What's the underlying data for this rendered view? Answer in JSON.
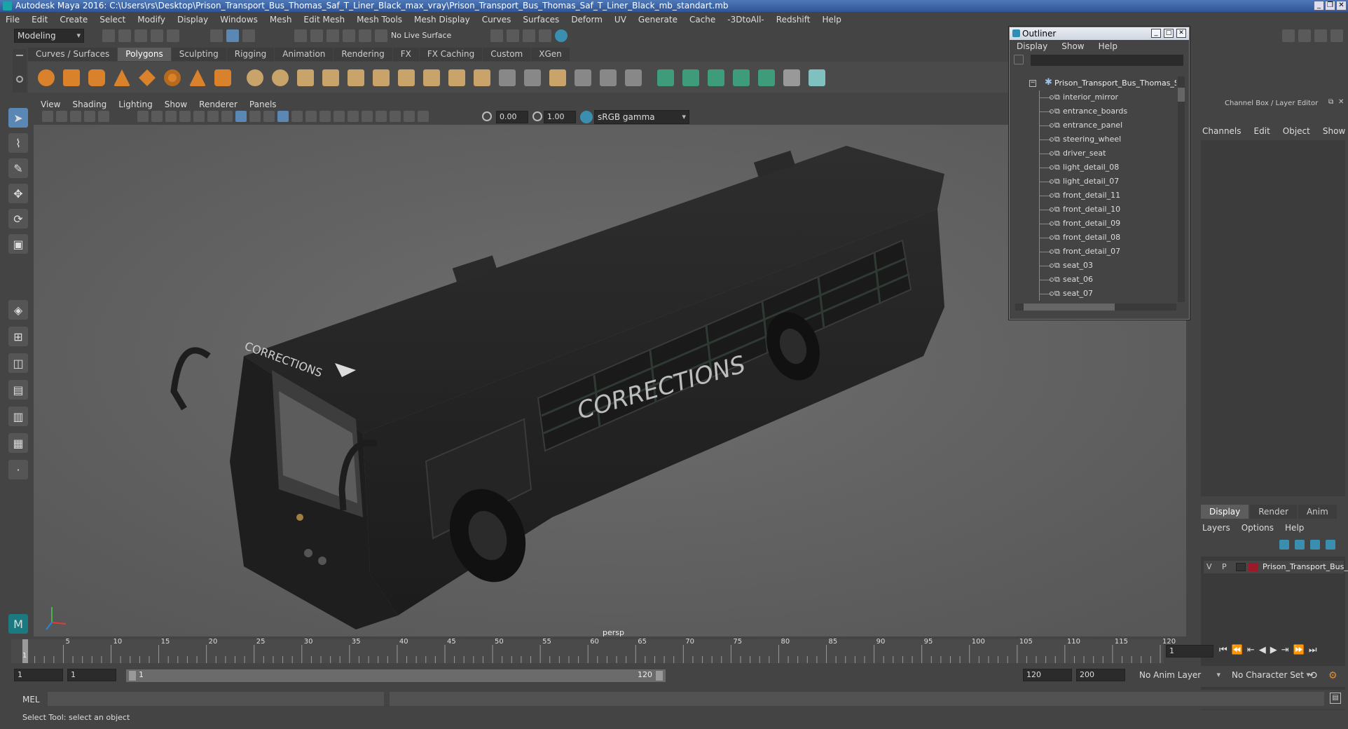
{
  "window": {
    "title": "Autodesk Maya 2016: C:\\Users\\rs\\Desktop\\Prison_Transport_Bus_Thomas_Saf_T_Liner_Black_max_vray\\Prison_Transport_Bus_Thomas_Saf_T_Liner_Black_mb_standart.mb"
  },
  "menubar": [
    "File",
    "Edit",
    "Create",
    "Select",
    "Modify",
    "Display",
    "Windows",
    "Mesh",
    "Edit Mesh",
    "Mesh Tools",
    "Mesh Display",
    "Curves",
    "Surfaces",
    "Deform",
    "UV",
    "Generate",
    "Cache",
    "-3DtoAll-",
    "Redshift",
    "Help"
  ],
  "statusline": {
    "mode": "Modeling",
    "live_surface": "No Live Surface"
  },
  "shelf": {
    "tabs": [
      "Curves / Surfaces",
      "Polygons",
      "Sculpting",
      "Rigging",
      "Animation",
      "Rendering",
      "FX",
      "FX Caching",
      "Custom",
      "XGen"
    ],
    "active_tab": "Polygons"
  },
  "viewport": {
    "menu": [
      "View",
      "Shading",
      "Lighting",
      "Show",
      "Renderer",
      "Panels"
    ],
    "exposure": "0.00",
    "gamma": "1.00",
    "color_space": "sRGB gamma",
    "camera_label": "persp",
    "bus_side_text": "CORRECTIONS",
    "bus_front_text": "CORRECTIONS"
  },
  "outliner": {
    "title": "Outliner",
    "menu": [
      "Display",
      "Show",
      "Help"
    ],
    "root": "Prison_Transport_Bus_Thomas_Sa",
    "items": [
      "interior_mirror",
      "entrance_boards",
      "entrance_panel",
      "steering_wheel",
      "driver_seat",
      "light_detail_08",
      "light_detail_07",
      "front_detail_11",
      "front_detail_10",
      "front_detail_09",
      "front_detail_08",
      "front_detail_07",
      "seat_03",
      "seat_06",
      "seat_07"
    ]
  },
  "channelbox": {
    "title": "Channel Box / Layer Editor",
    "menu": [
      "Channels",
      "Edit",
      "Object",
      "Show"
    ],
    "layer_tabs": [
      "Display",
      "Render",
      "Anim"
    ],
    "active_layer_tab": "Display",
    "layer_menu": [
      "Layers",
      "Options",
      "Help"
    ],
    "layer": {
      "v": "V",
      "p": "P",
      "name": "Prison_Transport_Bus_",
      "color": "#9b1a2a"
    }
  },
  "timeline": {
    "ticks": [
      "5",
      "10",
      "15",
      "20",
      "25",
      "30",
      "35",
      "40",
      "45",
      "50",
      "55",
      "60",
      "65",
      "70",
      "75",
      "80",
      "85",
      "90",
      "95",
      "100",
      "105",
      "110",
      "115",
      "120"
    ],
    "first_frame": "1",
    "current_frame": "1"
  },
  "range": {
    "start": "1",
    "start2": "1",
    "slider_start": "1",
    "slider_end": "120",
    "end": "120",
    "max": "200",
    "anim_layer": "No Anim Layer",
    "char_set": "No Character Set"
  },
  "cmdline": {
    "lang": "MEL"
  },
  "help": {
    "text": "Select Tool: select an object"
  },
  "colors": {
    "accent": "#5b87b4",
    "viewport_bg": "#6a6a6a",
    "ui_bg": "#444444"
  }
}
